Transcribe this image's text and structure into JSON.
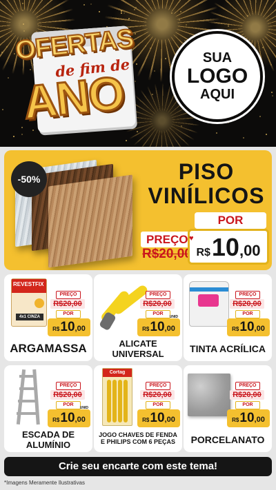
{
  "header": {
    "title_line1": "OFERTAS",
    "title_line2": "de fim de",
    "title_line3": "ANO",
    "logo_line1": "SUA",
    "logo_line2": "LOGO",
    "logo_line3": "AQUI"
  },
  "hero": {
    "discount_badge": "-50%",
    "title_line1": "PISO",
    "title_line2": "VINÍLICOS",
    "preco_label": "PREÇO",
    "old_price": "R$20,00",
    "por_label": "POR",
    "currency": "R$",
    "price_int": "10",
    "price_dec": ",00"
  },
  "products": [
    {
      "name": "ARGAMASSA",
      "preco_label": "PREÇO",
      "old_price": "R$20,00",
      "por_label": "POR",
      "currency": "R$",
      "price_int": "10",
      "price_dec": ",00",
      "unit": "",
      "brand": "REVESTFIX",
      "variant": "4x1 CINZA"
    },
    {
      "name": "ALICATE UNIVERSAL",
      "preco_label": "PREÇO",
      "old_price": "R$20,00",
      "por_label": "POR",
      "currency": "R$",
      "price_int": "10",
      "price_dec": ",00",
      "unit": "UNID"
    },
    {
      "name": "TINTA ACRÍLICA",
      "preco_label": "PREÇO",
      "old_price": "R$20,00",
      "por_label": "POR",
      "currency": "R$",
      "price_int": "10",
      "price_dec": ",00",
      "unit": ""
    },
    {
      "name": "ESCADA DE ALUMÍNIO",
      "preco_label": "PREÇO",
      "old_price": "R$20,00",
      "por_label": "POR",
      "currency": "R$",
      "price_int": "10",
      "price_dec": ",00",
      "unit": "UNID"
    },
    {
      "name": "JOGO CHAVES DE FENDA E PHILIPS COM 6 PEÇAS",
      "preco_label": "PREÇO",
      "old_price": "R$20,00",
      "por_label": "POR",
      "currency": "R$",
      "price_int": "10",
      "price_dec": ",00",
      "unit": "",
      "brand": "Cortag"
    },
    {
      "name": "PORCELANATO",
      "preco_label": "PREÇO",
      "old_price": "R$20,00",
      "por_label": "POR",
      "currency": "R$",
      "price_int": "10",
      "price_dec": ",00",
      "unit": ""
    }
  ],
  "cta": {
    "label": "Crie seu encarte com este tema!"
  },
  "footer": {
    "note": "*Imagens Meramente Ilustrativas"
  },
  "colors": {
    "accent_yellow": "#f4c02f",
    "price_red": "#c9151c",
    "dark": "#0c0b0a"
  }
}
